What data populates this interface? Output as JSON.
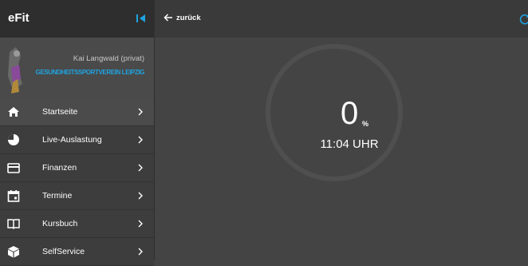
{
  "app": {
    "title": "eFit"
  },
  "profile": {
    "name": "Kai Langwald (privat)",
    "club": "GESUNDHEITSSPORTVEREIN LEIPZIG"
  },
  "nav": {
    "items": [
      {
        "label": "Startseite",
        "icon": "home-icon",
        "active": true
      },
      {
        "label": "Live-Auslastung",
        "icon": "pie-chart-icon"
      },
      {
        "label": "Finanzen",
        "icon": "credit-card-icon"
      },
      {
        "label": "Termine",
        "icon": "calendar-icon"
      },
      {
        "label": "Kursbuch",
        "icon": "book-icon"
      },
      {
        "label": "SelfService",
        "icon": "box-icon"
      }
    ]
  },
  "topbar": {
    "back_label": "zurück"
  },
  "gauge": {
    "value": "0",
    "unit": "%",
    "time": "11:04 UHR",
    "fill_fraction": 0
  },
  "colors": {
    "accent": "#1fa3e0",
    "background": "#444444",
    "sidebar": "#3b3b3b",
    "gauge_track": "#4f4f4f"
  }
}
